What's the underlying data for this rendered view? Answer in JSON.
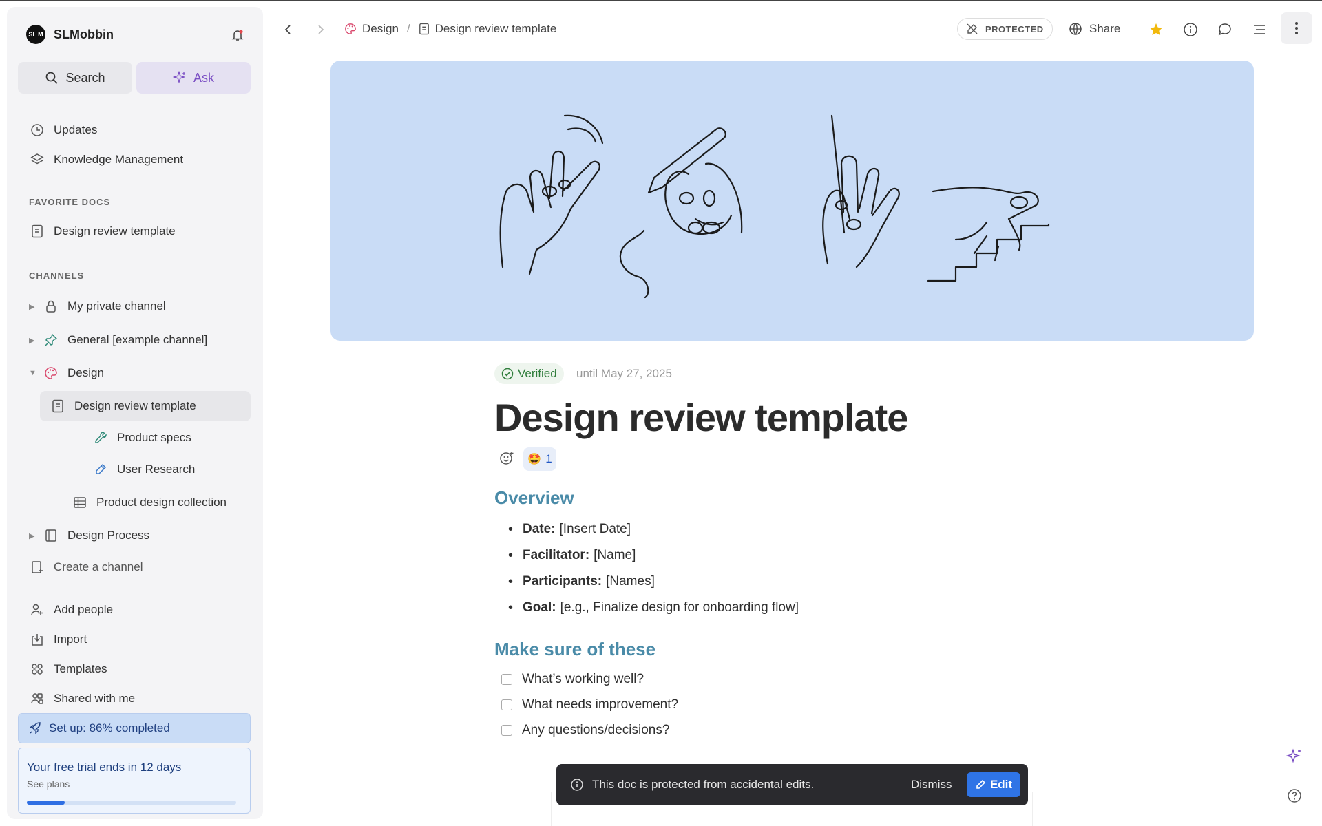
{
  "workspace": {
    "logo_text": "SL M",
    "name": "SLMobbin"
  },
  "sidebar": {
    "search_label": "Search",
    "ask_label": "Ask",
    "updates": "Updates",
    "knowledge": "Knowledge Management",
    "favorites_header": "FAVORITE DOCS",
    "favorite_doc": "Design review template",
    "channels_header": "CHANNELS",
    "channels": {
      "private": "My private channel",
      "general": "General [example channel]",
      "design": "Design",
      "design_review": "Design review template",
      "product_specs": "Product specs",
      "user_research": "User Research",
      "product_collection": "Product design collection",
      "design_process": "Design Process",
      "create": "Create a channel"
    },
    "add_people": "Add people",
    "import": "Import",
    "templates": "Templates",
    "shared": "Shared with me",
    "setup": "Set up: 86% completed",
    "trial_title": "Your free trial ends in 12 days",
    "trial_sub": "See plans",
    "trial_progress": 0.18
  },
  "topbar": {
    "breadcrumb_channel": "Design",
    "breadcrumb_sep": "/",
    "breadcrumb_doc": "Design review template",
    "protected": "PROTECTED",
    "share": "Share"
  },
  "doc": {
    "verified": "Verified",
    "until": "until May 27, 2025",
    "title": "Design review template",
    "reaction_emoji": "🤩",
    "reaction_count": "1",
    "overview_heading": "Overview",
    "overview": [
      {
        "label": "Date:",
        "value": "[Insert Date]"
      },
      {
        "label": "Facilitator:",
        "value": "[Name]"
      },
      {
        "label": "Participants:",
        "value": "[Names]"
      },
      {
        "label": "Goal:",
        "value": "[e.g., Finalize design for onboarding flow]"
      }
    ],
    "checks_heading": "Make sure of these",
    "checks": [
      "What’s working well?",
      "What needs improvement?",
      "Any questions/decisions?"
    ]
  },
  "toast": {
    "message": "This doc is protected from accidental edits.",
    "dismiss": "Dismiss",
    "edit": "Edit"
  },
  "colors": {
    "accent": "#2f74e6",
    "cover": "#c9dcf6",
    "heading": "#4a8ba8",
    "ask": "#7b4fc4"
  }
}
